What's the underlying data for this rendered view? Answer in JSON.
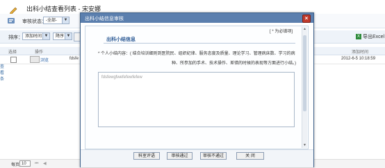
{
  "page": {
    "title": "出科小结查看列表 - 宋安娜",
    "filter": {
      "label": "审核状态：",
      "value": "-全部-"
    },
    "sort": {
      "label": "排序：",
      "field": "添加时间",
      "order": "降序"
    },
    "export_label": "导出Excel",
    "table": {
      "headers": [
        "选择",
        "操作",
        "添加时间"
      ],
      "row": {
        "action": "浏览",
        "name": "fdsfe",
        "time": "2012-6-5 10:18:59"
      }
    },
    "left_tabs": [
      "查",
      "看",
      "条"
    ],
    "pager": {
      "per_page": "10"
    }
  },
  "modal": {
    "title": "出科小结信息审核",
    "required_note": "[ * 为必填项]",
    "section_title": "出科小结信息",
    "field_label_line1": "* 个人小结内容：( 结合培训细则到医院民、组织纪律、服务态度及质量、理论学习、管理病床数、学习的病",
    "field_label_line2": "种、所参加的手术、技术操作、差错的时候的表现等方面进行小结。)",
    "content": "fdsfewgfwefefewfefew",
    "buttons": [
      "科室评语",
      "审核通过",
      "审核不通过",
      "关 闭"
    ]
  }
}
